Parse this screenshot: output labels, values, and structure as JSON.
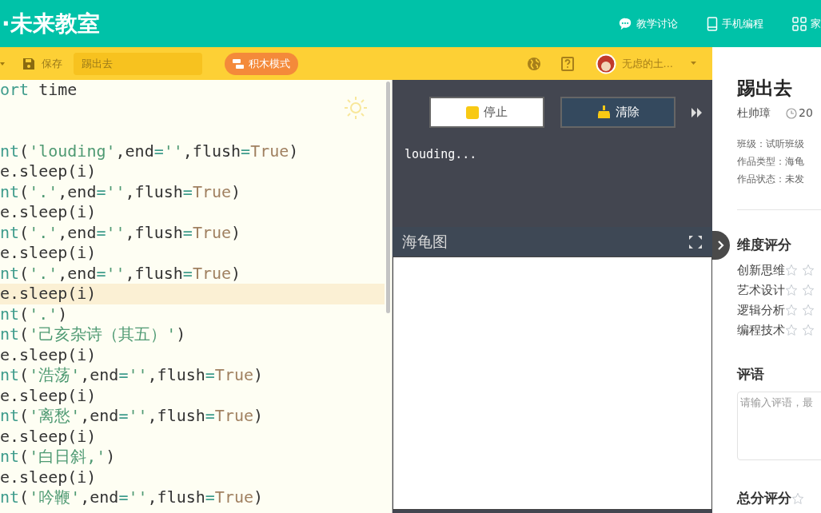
{
  "header": {
    "logo": "·未来教室",
    "nav": [
      {
        "label": "教学讨论"
      },
      {
        "label": "手机编程"
      },
      {
        "label": "家"
      }
    ]
  },
  "toolbar": {
    "save": "保存",
    "title_value": "踢出去",
    "mode_button": "积木模式",
    "user": "无虑的土..."
  },
  "editor": {
    "lines": [
      {
        "kind": "code",
        "active": false,
        "tokens": [
          {
            "t": "ort",
            "kind": "kw"
          },
          {
            "t": " time",
            "kind": "plain"
          }
        ]
      },
      {
        "kind": "blank"
      },
      {
        "kind": "blank"
      },
      {
        "kind": "code",
        "active": false,
        "tokens": [
          {
            "t": "nt",
            "kind": "kw"
          },
          {
            "t": "(",
            "kind": "plain"
          },
          {
            "t": "'louding'",
            "kind": "str"
          },
          {
            "t": ",end",
            "kind": "plain"
          },
          {
            "t": "=",
            "kind": "op"
          },
          {
            "t": "''",
            "kind": "str"
          },
          {
            "t": ",flush",
            "kind": "plain"
          },
          {
            "t": "=",
            "kind": "op"
          },
          {
            "t": "True",
            "kind": "const"
          },
          {
            "t": ")",
            "kind": "plain"
          }
        ]
      },
      {
        "kind": "code",
        "active": false,
        "tokens": [
          {
            "t": "e.sleep(i)",
            "kind": "plain"
          }
        ]
      },
      {
        "kind": "code",
        "active": false,
        "tokens": [
          {
            "t": "nt",
            "kind": "kw"
          },
          {
            "t": "(",
            "kind": "plain"
          },
          {
            "t": "'.'",
            "kind": "str"
          },
          {
            "t": ",end",
            "kind": "plain"
          },
          {
            "t": "=",
            "kind": "op"
          },
          {
            "t": "''",
            "kind": "str"
          },
          {
            "t": ",flush",
            "kind": "plain"
          },
          {
            "t": "=",
            "kind": "op"
          },
          {
            "t": "True",
            "kind": "const"
          },
          {
            "t": ")",
            "kind": "plain"
          }
        ]
      },
      {
        "kind": "code",
        "active": false,
        "tokens": [
          {
            "t": "e.sleep(i)",
            "kind": "plain"
          }
        ]
      },
      {
        "kind": "code",
        "active": false,
        "tokens": [
          {
            "t": "nt",
            "kind": "kw"
          },
          {
            "t": "(",
            "kind": "plain"
          },
          {
            "t": "'.'",
            "kind": "str"
          },
          {
            "t": ",end",
            "kind": "plain"
          },
          {
            "t": "=",
            "kind": "op"
          },
          {
            "t": "''",
            "kind": "str"
          },
          {
            "t": ",flush",
            "kind": "plain"
          },
          {
            "t": "=",
            "kind": "op"
          },
          {
            "t": "True",
            "kind": "const"
          },
          {
            "t": ")",
            "kind": "plain"
          }
        ]
      },
      {
        "kind": "code",
        "active": false,
        "tokens": [
          {
            "t": "e.sleep(i)",
            "kind": "plain"
          }
        ]
      },
      {
        "kind": "code",
        "active": false,
        "tokens": [
          {
            "t": "nt",
            "kind": "kw"
          },
          {
            "t": "(",
            "kind": "plain"
          },
          {
            "t": "'.'",
            "kind": "str"
          },
          {
            "t": ",end",
            "kind": "plain"
          },
          {
            "t": "=",
            "kind": "op"
          },
          {
            "t": "''",
            "kind": "str"
          },
          {
            "t": ",flush",
            "kind": "plain"
          },
          {
            "t": "=",
            "kind": "op"
          },
          {
            "t": "True",
            "kind": "const"
          },
          {
            "t": ")",
            "kind": "plain"
          }
        ]
      },
      {
        "kind": "code",
        "active": true,
        "tokens": [
          {
            "t": "e.sleep(i)",
            "kind": "plain"
          }
        ]
      },
      {
        "kind": "code",
        "active": false,
        "tokens": [
          {
            "t": "nt",
            "kind": "kw"
          },
          {
            "t": "(",
            "kind": "plain"
          },
          {
            "t": "'.'",
            "kind": "str"
          },
          {
            "t": ")",
            "kind": "plain"
          }
        ]
      },
      {
        "kind": "code",
        "active": false,
        "tokens": [
          {
            "t": "nt",
            "kind": "kw"
          },
          {
            "t": "(",
            "kind": "plain"
          },
          {
            "t": "'己亥杂诗（其五）'",
            "kind": "str"
          },
          {
            "t": ")",
            "kind": "plain"
          }
        ]
      },
      {
        "kind": "code",
        "active": false,
        "tokens": [
          {
            "t": "e.sleep(i)",
            "kind": "plain"
          }
        ]
      },
      {
        "kind": "code",
        "active": false,
        "tokens": [
          {
            "t": "nt",
            "kind": "kw"
          },
          {
            "t": "(",
            "kind": "plain"
          },
          {
            "t": "'浩荡'",
            "kind": "str"
          },
          {
            "t": ",end",
            "kind": "plain"
          },
          {
            "t": "=",
            "kind": "op"
          },
          {
            "t": "''",
            "kind": "str"
          },
          {
            "t": ",flush",
            "kind": "plain"
          },
          {
            "t": "=",
            "kind": "op"
          },
          {
            "t": "True",
            "kind": "const"
          },
          {
            "t": ")",
            "kind": "plain"
          }
        ]
      },
      {
        "kind": "code",
        "active": false,
        "tokens": [
          {
            "t": "e.sleep(i)",
            "kind": "plain"
          }
        ]
      },
      {
        "kind": "code",
        "active": false,
        "tokens": [
          {
            "t": "nt",
            "kind": "kw"
          },
          {
            "t": "(",
            "kind": "plain"
          },
          {
            "t": "'离愁'",
            "kind": "str"
          },
          {
            "t": ",end",
            "kind": "plain"
          },
          {
            "t": "=",
            "kind": "op"
          },
          {
            "t": "''",
            "kind": "str"
          },
          {
            "t": ",flush",
            "kind": "plain"
          },
          {
            "t": "=",
            "kind": "op"
          },
          {
            "t": "True",
            "kind": "const"
          },
          {
            "t": ")",
            "kind": "plain"
          }
        ]
      },
      {
        "kind": "code",
        "active": false,
        "tokens": [
          {
            "t": "e.sleep(i)",
            "kind": "plain"
          }
        ]
      },
      {
        "kind": "code",
        "active": false,
        "tokens": [
          {
            "t": "nt",
            "kind": "kw"
          },
          {
            "t": "(",
            "kind": "plain"
          },
          {
            "t": "'白日斜,'",
            "kind": "str"
          },
          {
            "t": ")",
            "kind": "plain"
          }
        ]
      },
      {
        "kind": "code",
        "active": false,
        "tokens": [
          {
            "t": "e.sleep(i)",
            "kind": "plain"
          }
        ]
      },
      {
        "kind": "code",
        "active": false,
        "tokens": [
          {
            "t": "nt",
            "kind": "kw"
          },
          {
            "t": "(",
            "kind": "plain"
          },
          {
            "t": "'吟鞭'",
            "kind": "str"
          },
          {
            "t": ",end",
            "kind": "plain"
          },
          {
            "t": "=",
            "kind": "op"
          },
          {
            "t": "''",
            "kind": "str"
          },
          {
            "t": ",flush",
            "kind": "plain"
          },
          {
            "t": "=",
            "kind": "op"
          },
          {
            "t": "True",
            "kind": "const"
          },
          {
            "t": ")",
            "kind": "plain"
          }
        ]
      }
    ]
  },
  "output": {
    "stop_button": "停止",
    "clear_button": "清除",
    "console": "louding...",
    "turtle_title": "海龟图"
  },
  "details": {
    "title": "踢出去",
    "author": "杜帅璋",
    "date": "20",
    "info": [
      "班级：试听班级",
      "作品类型：海龟",
      "作品状态：未发"
    ],
    "ratings_heading": "维度评分",
    "ratings": [
      {
        "label": "创新思维"
      },
      {
        "label": "艺术设计"
      },
      {
        "label": "逻辑分析"
      },
      {
        "label": "编程技术"
      }
    ],
    "comment_heading": "评语",
    "comment_placeholder": "请输入评语，最",
    "total": {
      "heading": "总分评分"
    }
  }
}
